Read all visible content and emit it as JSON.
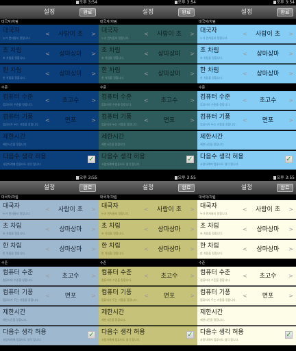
{
  "status_time": "오후 3:54",
  "status_time_bottom": "오후 3:55",
  "title": "설정",
  "done_label": "완료",
  "section_matchmaking": "대국자/차림",
  "section_computer": "수준",
  "rows": {
    "opponent": {
      "label": "대국자",
      "sub": "누가 먼저둘지 정합니다.",
      "value": "사람이 초"
    },
    "cho_setup": {
      "label": "초 차림",
      "sub": "초 차림을 정합니다.",
      "value": "상마상마"
    },
    "han_setup": {
      "label": "한 차림",
      "sub": "한 차림을 정합니다.",
      "value": "상마상마"
    },
    "comp_level": {
      "label": "컴퓨터 수준",
      "sub": "컴퓨터의 수준을 정합니다.",
      "value": "초고수"
    },
    "comp_style": {
      "label": "컴퓨터 기풍",
      "sub": "컴퓨터가 두는 기풍을 정합니다.",
      "value": "면포"
    },
    "time_limit": {
      "label": "제한시간",
      "sub": "제한시간을 정합니다."
    },
    "next_move": {
      "label": "다음수 생각 허용",
      "sub": "사람차례에 컴퓨터도 생각 합니다.",
      "checked": true
    }
  },
  "themes": [
    {
      "bg": "#0a3f7c",
      "text": "#0a1930",
      "sub": "#6d8fb8"
    },
    {
      "bg": "#2e5c5c",
      "text": "#0f1f1f",
      "sub": "#7d9d9d"
    },
    {
      "bg": "#86cdf5",
      "text": "#0b1b28",
      "sub": "#4a86aa"
    },
    {
      "bg": "#9eb8cf",
      "text": "#1b2733",
      "sub": "#5d7a94"
    },
    {
      "bg": "#c6c27a",
      "text": "#1f1f0e",
      "sub": "#86823e"
    },
    {
      "bg": "#fdfde8",
      "text": "#1a1a10",
      "sub": "#9a9a7a"
    }
  ],
  "arrow_left": "<",
  "arrow_right": ">",
  "check_mark": "✓"
}
